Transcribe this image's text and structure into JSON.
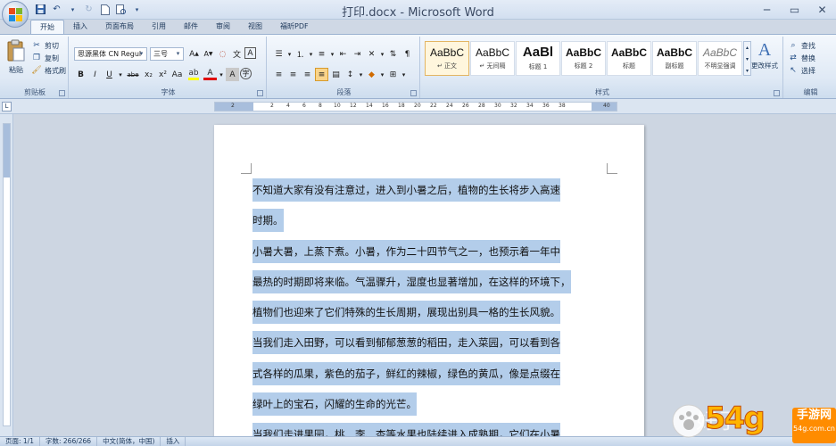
{
  "window": {
    "title": "打印.docx - Microsoft Word",
    "controls": {
      "minimize": "─",
      "maximize": "▭",
      "close": "✕"
    }
  },
  "quick_access": [
    "save-icon",
    "undo-icon",
    "redo-icon",
    "new-icon",
    "print-preview-icon",
    "customize-icon"
  ],
  "tabs": [
    {
      "label": "开始",
      "active": true
    },
    {
      "label": "插入"
    },
    {
      "label": "页面布局"
    },
    {
      "label": "引用"
    },
    {
      "label": "邮件"
    },
    {
      "label": "审阅"
    },
    {
      "label": "视图"
    },
    {
      "label": "福昕PDF"
    }
  ],
  "ribbon": {
    "clipboard": {
      "label": "剪贴板",
      "paste": "粘贴",
      "cut": "剪切",
      "copy": "复制",
      "format_painter": "格式刷"
    },
    "font": {
      "label": "字体",
      "font_name": "思源黑体 CN Regul",
      "font_size": "三号",
      "buttons": [
        "B",
        "I",
        "U",
        "abe",
        "x₂",
        "x²",
        "Aa",
        "A",
        "A"
      ]
    },
    "paragraph": {
      "label": "段落"
    },
    "styles": {
      "label": "样式",
      "items": [
        {
          "sample": "AaBbC",
          "name": "↵ 正文",
          "selected": true
        },
        {
          "sample": "AaBbC",
          "name": "↵ 无间隔"
        },
        {
          "sample": "AaBl",
          "name": "标题 1"
        },
        {
          "sample": "AaBbC",
          "name": "标题 2"
        },
        {
          "sample": "AaBbC",
          "name": "标题"
        },
        {
          "sample": "AaBbC",
          "name": "副标题"
        },
        {
          "sample": "AaBbC",
          "name": "不明显强调"
        }
      ],
      "change_styles": "更改样式"
    },
    "editing": {
      "label": "编辑",
      "find": "查找",
      "replace": "替换",
      "select": "选择"
    }
  },
  "ruler": {
    "ticks": [
      "2",
      "2",
      "4",
      "6",
      "8",
      "10",
      "12",
      "14",
      "16",
      "18",
      "20",
      "22",
      "24",
      "26",
      "28",
      "30",
      "32",
      "34",
      "36",
      "38",
      "40"
    ]
  },
  "document": {
    "lines": [
      "不知道大家有没有注意过，进入到小暑之后，植物的生长将步入高速",
      "时期。",
      "小暑大暑，上蒸下煮。小暑，作为二十四节气之一，也预示着一年中",
      "最热的时期即将来临。气温骤升，湿度也显著增加，在这样的环境下，",
      "植物们也迎来了它们特殊的生长周期，展现出别具一格的生长风貌。",
      "当我们走入田野，可以看到郁郁葱葱的稻田，走入菜园，可以看到各",
      "式各样的瓜果，紫色的茄子，鲜红的辣椒，绿色的黄瓜，像是点缀在",
      "绿叶上的宝石，闪耀的生命的光芒。",
      "当我们走进果园，桃、李、杏等水果也陆续进入成熟期，它们在小暑"
    ]
  },
  "status": {
    "page": "页面: 1/1",
    "words": "字数: 266/266",
    "language": "中文(简体，中国)",
    "mode": "插入"
  },
  "watermark": {
    "brand": "54g",
    "text": "手游网",
    "url": "54g.com.cn",
    "faint": "好子"
  },
  "colors": {
    "selection": "#b3cdea",
    "ribbon": "#dfe9f5",
    "accent": "#2a4f84"
  }
}
